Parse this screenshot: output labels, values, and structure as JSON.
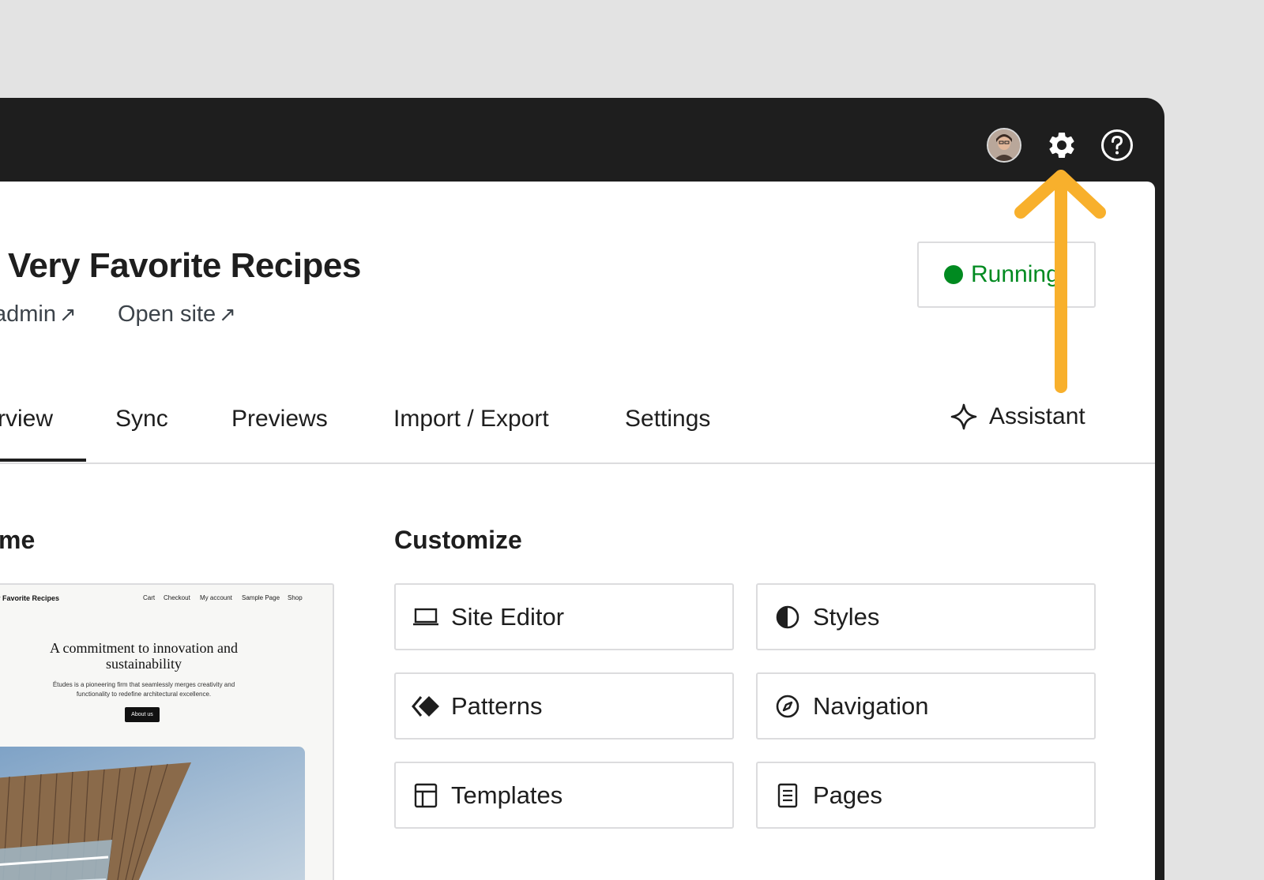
{
  "header": {
    "site_title": "Very Favorite Recipes",
    "links": [
      {
        "label": "admin",
        "arrow": "↗"
      },
      {
        "label": "Open site",
        "arrow": "↗"
      }
    ],
    "status": {
      "label": "Running",
      "color": "#008a20"
    }
  },
  "topbar": {
    "icons": [
      "avatar",
      "gear-icon",
      "help-icon"
    ]
  },
  "tabs": [
    {
      "label": "rview",
      "active": true
    },
    {
      "label": "Sync"
    },
    {
      "label": "Previews"
    },
    {
      "label": "Import / Export"
    },
    {
      "label": "Settings"
    }
  ],
  "assistant": {
    "label": "Assistant"
  },
  "theme": {
    "heading": "me",
    "preview": {
      "site_name": "ry Favorite Recipes",
      "nav": [
        "Cart",
        "Checkout",
        "My account",
        "Sample Page",
        "Shop"
      ],
      "headline": "A commitment to innovation and sustainability",
      "description": "Études is a pioneering firm that seamlessly merges creativity and functionality to redefine architectural excellence.",
      "button": "About us"
    }
  },
  "customize": {
    "heading": "Customize",
    "items": [
      {
        "label": "Site Editor",
        "icon": "laptop-icon"
      },
      {
        "label": "Styles",
        "icon": "contrast-icon"
      },
      {
        "label": "Patterns",
        "icon": "patterns-icon"
      },
      {
        "label": "Navigation",
        "icon": "compass-icon"
      },
      {
        "label": "Templates",
        "icon": "layout-icon"
      },
      {
        "label": "Pages",
        "icon": "page-icon"
      }
    ]
  },
  "colors": {
    "accent_arrow": "#f8b02c",
    "topbar": "#1e1e1e",
    "running": "#008a20"
  }
}
